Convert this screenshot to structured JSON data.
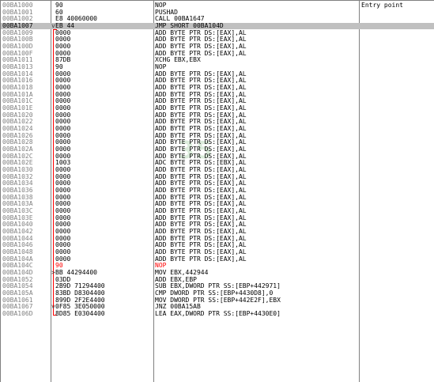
{
  "colors": {
    "address": "#808080",
    "selection": "#c0c0c0",
    "jump_arrow": "#ff0000",
    "highlight_text": "#ff0000"
  },
  "watermark": "35",
  "rows": [
    {
      "addr": "00BA1000",
      "arrow": "",
      "hex": "90",
      "asm": "NOP",
      "comment": "Entry point"
    },
    {
      "addr": "00BA1001",
      "arrow": "",
      "hex": "60",
      "asm": "PUSHAD",
      "comment": ""
    },
    {
      "addr": "00BA1002",
      "arrow": "",
      "hex": "E8 40060000",
      "asm": "CALL 00BA1647",
      "comment": ""
    },
    {
      "addr": "00BA1007",
      "arrow": "v",
      "hex": "EB 44",
      "asm": "JMP SHORT 00BA104D",
      "comment": "",
      "selected": true
    },
    {
      "addr": "00BA1009",
      "arrow": "",
      "hex": "0000",
      "asm": "ADD BYTE PTR DS:[EAX],AL",
      "comment": ""
    },
    {
      "addr": "00BA100B",
      "arrow": "",
      "hex": "0000",
      "asm": "ADD BYTE PTR DS:[EAX],AL",
      "comment": ""
    },
    {
      "addr": "00BA100D",
      "arrow": "",
      "hex": "0000",
      "asm": "ADD BYTE PTR DS:[EAX],AL",
      "comment": ""
    },
    {
      "addr": "00BA100F",
      "arrow": "",
      "hex": "0000",
      "asm": "ADD BYTE PTR DS:[EAX],AL",
      "comment": ""
    },
    {
      "addr": "00BA1011",
      "arrow": "",
      "hex": "87DB",
      "asm": "XCHG EBX,EBX",
      "comment": ""
    },
    {
      "addr": "00BA1013",
      "arrow": "",
      "hex": "90",
      "asm": "NOP",
      "comment": ""
    },
    {
      "addr": "00BA1014",
      "arrow": "",
      "hex": "0000",
      "asm": "ADD BYTE PTR DS:[EAX],AL",
      "comment": ""
    },
    {
      "addr": "00BA1016",
      "arrow": "",
      "hex": "0000",
      "asm": "ADD BYTE PTR DS:[EAX],AL",
      "comment": ""
    },
    {
      "addr": "00BA1018",
      "arrow": "",
      "hex": "0000",
      "asm": "ADD BYTE PTR DS:[EAX],AL",
      "comment": ""
    },
    {
      "addr": "00BA101A",
      "arrow": "",
      "hex": "0000",
      "asm": "ADD BYTE PTR DS:[EAX],AL",
      "comment": ""
    },
    {
      "addr": "00BA101C",
      "arrow": "",
      "hex": "0000",
      "asm": "ADD BYTE PTR DS:[EAX],AL",
      "comment": ""
    },
    {
      "addr": "00BA101E",
      "arrow": "",
      "hex": "0000",
      "asm": "ADD BYTE PTR DS:[EAX],AL",
      "comment": ""
    },
    {
      "addr": "00BA1020",
      "arrow": "",
      "hex": "0000",
      "asm": "ADD BYTE PTR DS:[EAX],AL",
      "comment": ""
    },
    {
      "addr": "00BA1022",
      "arrow": "",
      "hex": "0000",
      "asm": "ADD BYTE PTR DS:[EAX],AL",
      "comment": ""
    },
    {
      "addr": "00BA1024",
      "arrow": "",
      "hex": "0000",
      "asm": "ADD BYTE PTR DS:[EAX],AL",
      "comment": ""
    },
    {
      "addr": "00BA1026",
      "arrow": "",
      "hex": "0000",
      "asm": "ADD BYTE PTR DS:[EAX],AL",
      "comment": ""
    },
    {
      "addr": "00BA1028",
      "arrow": "",
      "hex": "0000",
      "asm": "ADD BYTE PTR DS:[EAX],AL",
      "comment": ""
    },
    {
      "addr": "00BA102A",
      "arrow": "",
      "hex": "0000",
      "asm": "ADD BYTE PTR DS:[EAX],AL",
      "comment": ""
    },
    {
      "addr": "00BA102C",
      "arrow": "",
      "hex": "0000",
      "asm": "ADD BYTE PTR DS:[EAX],AL",
      "comment": ""
    },
    {
      "addr": "00BA102E",
      "arrow": "",
      "hex": "1003",
      "asm": "ADC BYTE PTR DS:[EBX],AL",
      "comment": ""
    },
    {
      "addr": "00BA1030",
      "arrow": "",
      "hex": "0000",
      "asm": "ADD BYTE PTR DS:[EAX],AL",
      "comment": ""
    },
    {
      "addr": "00BA1032",
      "arrow": "",
      "hex": "0000",
      "asm": "ADD BYTE PTR DS:[EAX],AL",
      "comment": ""
    },
    {
      "addr": "00BA1034",
      "arrow": "",
      "hex": "0000",
      "asm": "ADD BYTE PTR DS:[EAX],AL",
      "comment": ""
    },
    {
      "addr": "00BA1036",
      "arrow": "",
      "hex": "0000",
      "asm": "ADD BYTE PTR DS:[EAX],AL",
      "comment": ""
    },
    {
      "addr": "00BA1038",
      "arrow": "",
      "hex": "0000",
      "asm": "ADD BYTE PTR DS:[EAX],AL",
      "comment": ""
    },
    {
      "addr": "00BA103A",
      "arrow": "",
      "hex": "0000",
      "asm": "ADD BYTE PTR DS:[EAX],AL",
      "comment": ""
    },
    {
      "addr": "00BA103C",
      "arrow": "",
      "hex": "0000",
      "asm": "ADD BYTE PTR DS:[EAX],AL",
      "comment": ""
    },
    {
      "addr": "00BA103E",
      "arrow": "",
      "hex": "0000",
      "asm": "ADD BYTE PTR DS:[EAX],AL",
      "comment": ""
    },
    {
      "addr": "00BA1040",
      "arrow": "",
      "hex": "0000",
      "asm": "ADD BYTE PTR DS:[EAX],AL",
      "comment": ""
    },
    {
      "addr": "00BA1042",
      "arrow": "",
      "hex": "0000",
      "asm": "ADD BYTE PTR DS:[EAX],AL",
      "comment": ""
    },
    {
      "addr": "00BA1044",
      "arrow": "",
      "hex": "0000",
      "asm": "ADD BYTE PTR DS:[EAX],AL",
      "comment": ""
    },
    {
      "addr": "00BA1046",
      "arrow": "",
      "hex": "0000",
      "asm": "ADD BYTE PTR DS:[EAX],AL",
      "comment": ""
    },
    {
      "addr": "00BA1048",
      "arrow": "",
      "hex": "0000",
      "asm": "ADD BYTE PTR DS:[EAX],AL",
      "comment": ""
    },
    {
      "addr": "00BA104A",
      "arrow": "",
      "hex": "0000",
      "asm": "ADD BYTE PTR DS:[EAX],AL",
      "comment": ""
    },
    {
      "addr": "00BA104C",
      "arrow": "",
      "hex": "90",
      "asm": "NOP",
      "comment": "",
      "red": true
    },
    {
      "addr": "00BA104D",
      "arrow": ">",
      "hex": "BB 44294400",
      "asm": "MOV EBX,442944",
      "comment": ""
    },
    {
      "addr": "00BA1052",
      "arrow": "",
      "hex": "03DD",
      "asm": "ADD EBX,EBP",
      "comment": ""
    },
    {
      "addr": "00BA1054",
      "arrow": "",
      "hex": "2B9D 71294400",
      "asm": "SUB EBX,DWORD PTR SS:[EBP+442971]",
      "comment": ""
    },
    {
      "addr": "00BA105A",
      "arrow": "",
      "hex": "83BD D8304400",
      "asm": "CMP DWORD PTR SS:[EBP+4430D8],0",
      "comment": ""
    },
    {
      "addr": "00BA1061",
      "arrow": "",
      "hex": "899D 2F2E4400",
      "asm": "MOV DWORD PTR SS:[EBP+442E2F],EBX",
      "comment": ""
    },
    {
      "addr": "00BA1067",
      "arrow": "v",
      "hex": "0F85 3E050000",
      "asm": "JNZ 00BA15AB",
      "comment": ""
    },
    {
      "addr": "00BA106D",
      "arrow": "",
      "hex": "8D85 E0304400",
      "asm": "LEA EAX,DWORD PTR SS:[EBP+4430E0]",
      "comment": ""
    }
  ]
}
